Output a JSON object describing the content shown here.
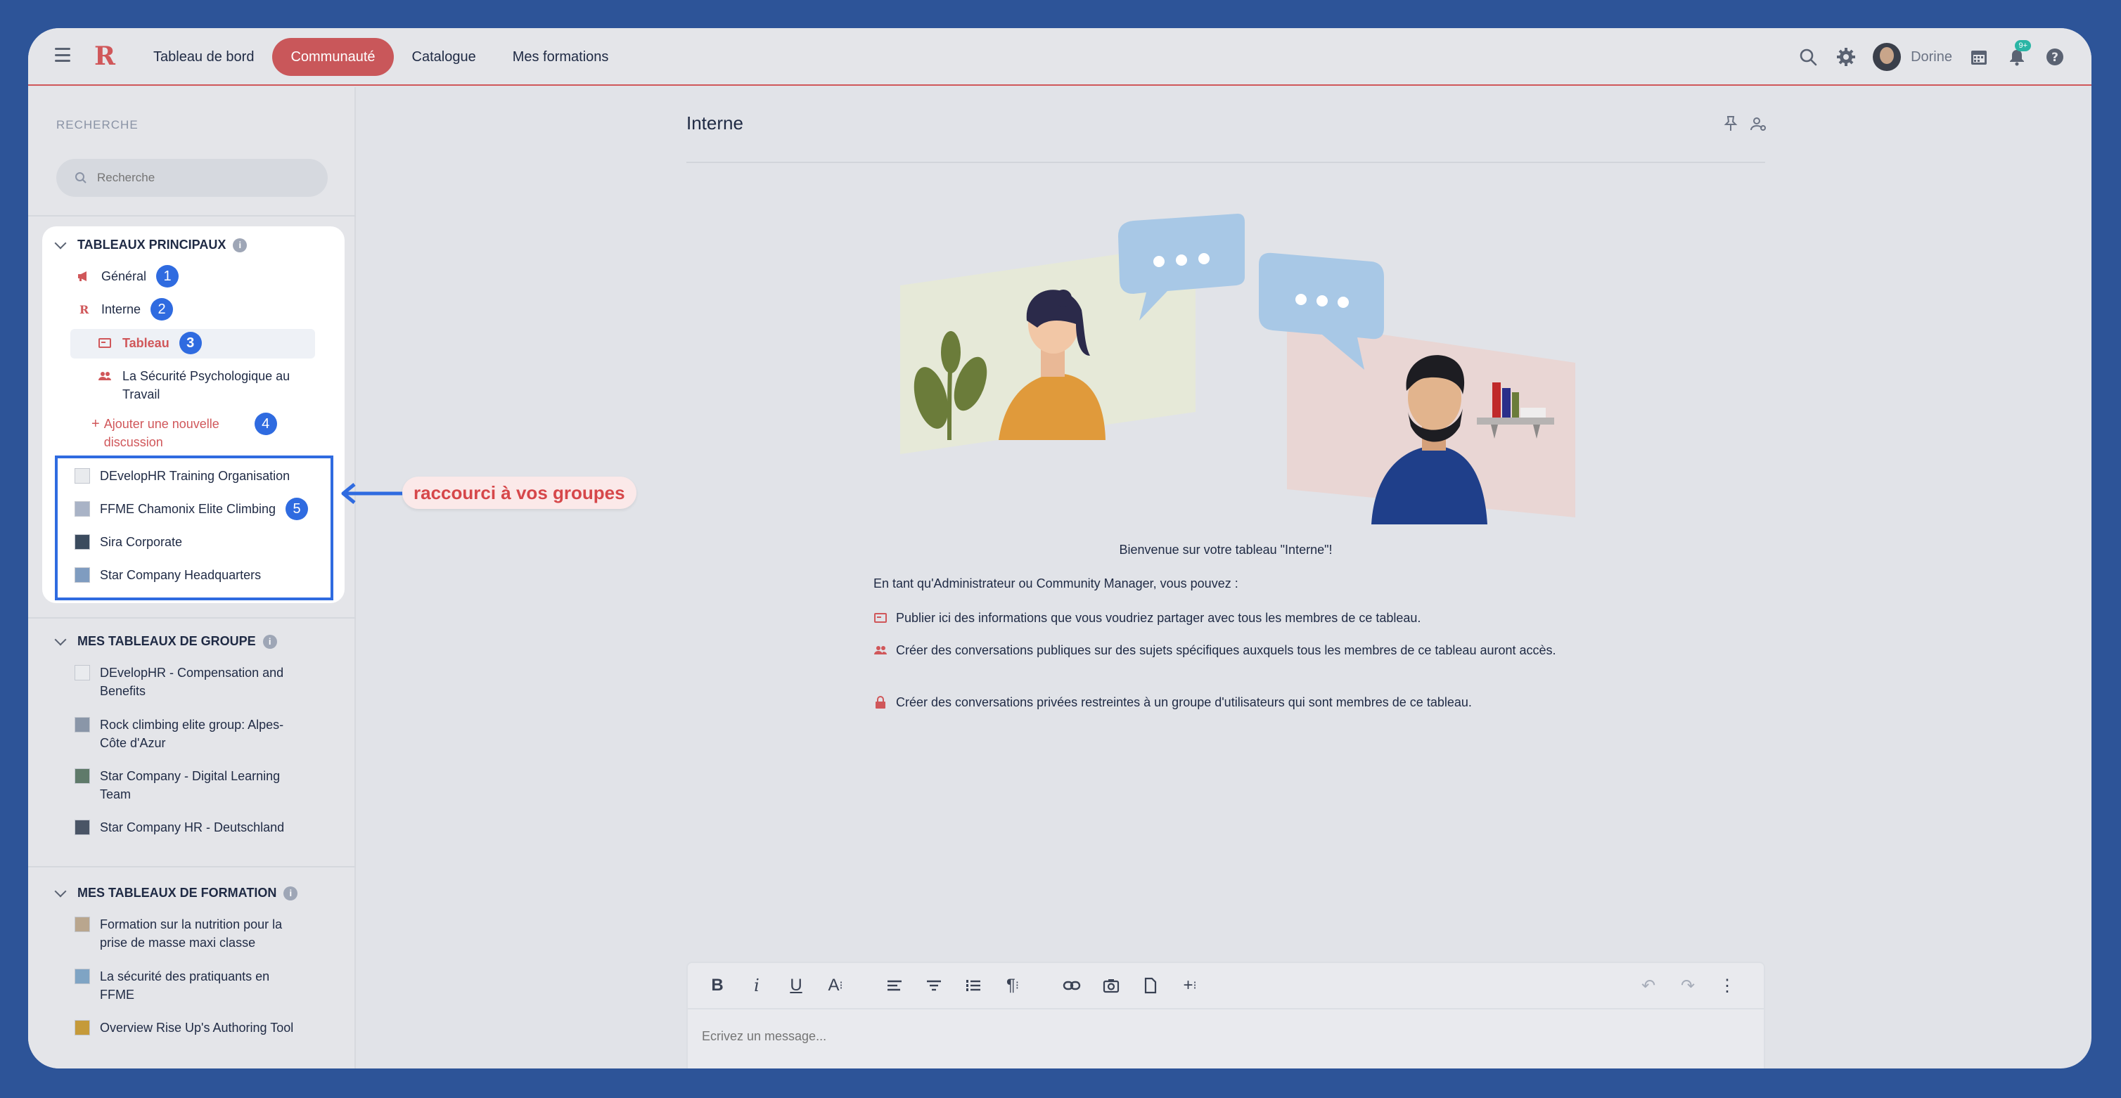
{
  "nav": {
    "items": [
      "Tableau de bord",
      "Communauté",
      "Catalogue",
      "Mes formations"
    ],
    "active_index": 1,
    "user_name": "Dorine",
    "notification_badge": "9+"
  },
  "sidebar": {
    "search_label": "RECHERCHE",
    "search_placeholder": "Recherche",
    "main_section": {
      "title": "TABLEAUX PRINCIPAUX",
      "items": [
        {
          "label": "Général",
          "number": "1",
          "icon": "megaphone-icon"
        },
        {
          "label": "Interne",
          "number": "2",
          "icon": "logo-icon"
        },
        {
          "label": "Tableau",
          "number": "3",
          "icon": "board-icon",
          "active": true
        },
        {
          "label": "La Sécurité Psychologique au Travail",
          "icon": "users-icon"
        },
        {
          "label": "Ajouter une nouvelle discussion",
          "number": "4",
          "icon": "plus-icon"
        }
      ],
      "groups": [
        {
          "label": "DEvelopHR Training Organisation"
        },
        {
          "label": "FFME Chamonix Elite Climbing",
          "number": "5"
        },
        {
          "label": "Sira Corporate"
        },
        {
          "label": "Star Company Headquarters"
        }
      ]
    },
    "group_section": {
      "title": "MES TABLEAUX DE GROUPE",
      "items": [
        "DEvelopHR - Compensation and Benefits",
        "Rock climbing elite group: Alpes-Côte d'Azur",
        "Star Company - Digital Learning Team",
        "Star Company HR - Deutschland"
      ]
    },
    "training_section": {
      "title": "MES TABLEAUX DE FORMATION",
      "items": [
        "Formation sur la nutrition pour la prise de masse maxi classe",
        "La sécurité des pratiquants en FFME",
        "Overview Rise Up's Authoring Tool"
      ]
    }
  },
  "annotation": "raccourci à vos groupes",
  "main": {
    "title": "Interne",
    "welcome": "Bienvenue sur votre tableau \"Interne\"!",
    "intro": "En tant qu'Administrateur ou Community Manager, vous pouvez :",
    "bullets": [
      "Publier ici des informations que vous voudriez partager avec tous les membres de ce tableau.",
      "Créer des conversations publiques sur des sujets spécifiques auxquels tous les membres de ce tableau auront accès.",
      "Créer des conversations privées restreintes à un groupe d'utilisateurs qui sont membres de ce tableau."
    ]
  },
  "editor": {
    "placeholder": "Ecrivez un message..."
  },
  "colors": {
    "accent": "#c9575a",
    "badge_blue": "#2f6be0",
    "annotation_red": "#d6474a"
  }
}
